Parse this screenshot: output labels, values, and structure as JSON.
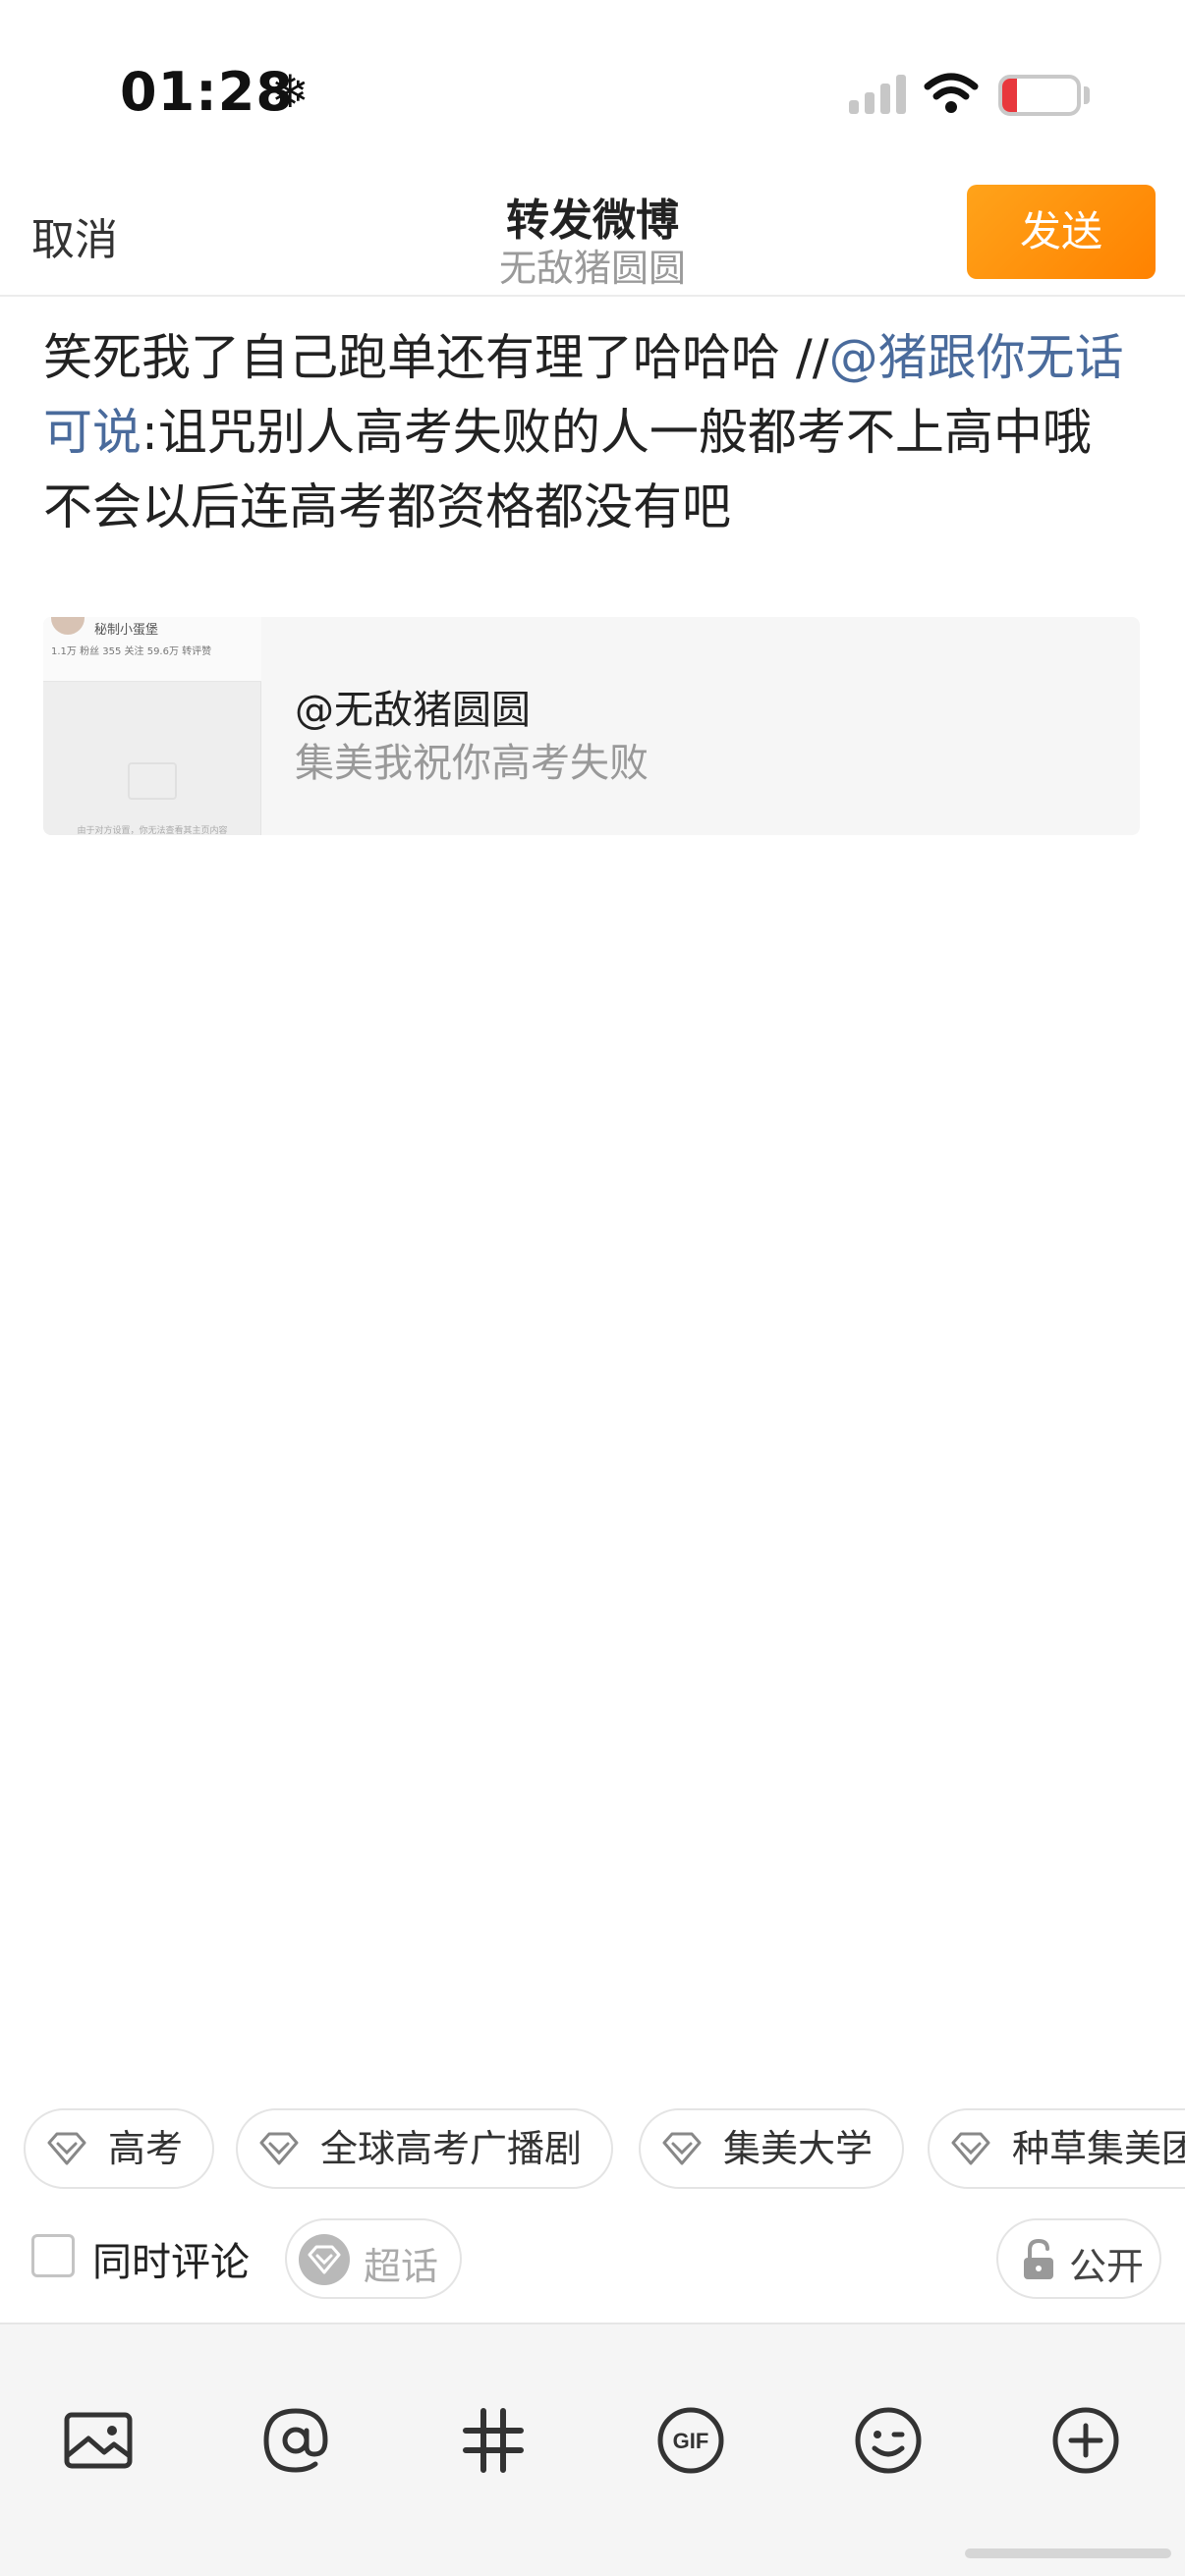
{
  "status_bar": {
    "time": "01:28",
    "extra_icon": "❄",
    "battery_level": "20",
    "battery_fraction": 0.2,
    "battery_color": "#e8383d"
  },
  "header": {
    "cancel_label": "取消",
    "title": "转发微博",
    "subtitle": "无敌猪圆圆",
    "send_label": "发送",
    "send_color": "#ff8f0d"
  },
  "compose": {
    "text_before": "笑死我了自己跑单还有理了哈哈哈 //",
    "mention": "@猪跟你无话可说",
    "text_after": ":诅咒别人高考失败的人一般都考不上高中哦 不会以后连高考都资格都没有吧",
    "mention_color": "#4a6b9c"
  },
  "quote": {
    "thumb_name": "秘制小蛋堡",
    "thumb_stats": "1.1万 粉丝   355 关注   59.6万 转评赞",
    "thumb_footer": "由于对方设置，你无法查看其主页内容",
    "user": "@无敌猪圆圆",
    "text": "集美我祝你高考失败"
  },
  "topics": [
    {
      "label": "高考",
      "icon": "diamond-icon"
    },
    {
      "label": "全球高考广播剧",
      "icon": "diamond-icon"
    },
    {
      "label": "集美大学",
      "icon": "diamond-icon"
    },
    {
      "label": "种草集美团",
      "icon": "diamond-icon"
    }
  ],
  "options": {
    "also_comment_label": "同时评论",
    "also_comment_checked": false,
    "supertopic_label": "超话",
    "visibility_label": "公开"
  },
  "toolbar": {
    "items": [
      "image-icon",
      "at-icon",
      "hashtag-icon",
      "gif-icon",
      "emoji-icon",
      "plus-icon"
    ]
  }
}
